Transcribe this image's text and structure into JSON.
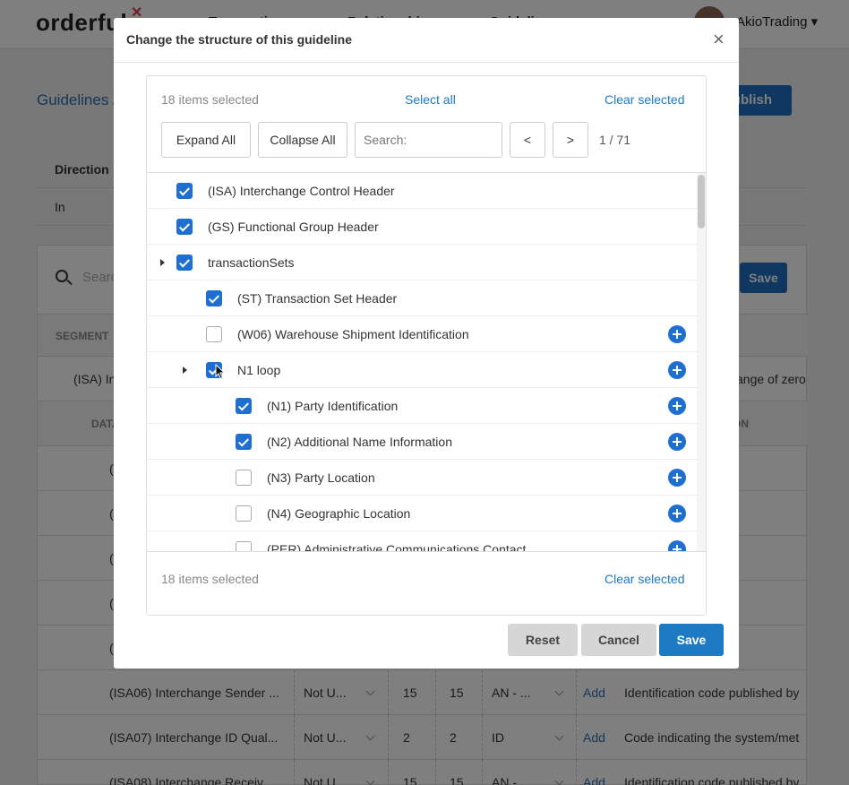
{
  "background": {
    "logo": "orderful",
    "nav": [
      "Transactions",
      "Relationships",
      "Guidelines"
    ],
    "account": "AkioTrading ▾",
    "breadcrumb": "Guidelines /",
    "publish": "Publish",
    "direction_header": "Direction",
    "direction_value": "In",
    "search_placeholder": "Search",
    "save": "Save",
    "segment_header": "SEGMENT",
    "segment_row": "(ISA) In",
    "segment_desc": "ange of zero",
    "data_header": "DATA",
    "description_header": "ON",
    "rows": [
      {
        "name": "(I",
        "desc": "type of info"
      },
      {
        "name": "(I",
        "desc": "additional"
      },
      {
        "name": "(I",
        "desc": "type of info"
      },
      {
        "name": "(I",
        "desc": "tifying the s"
      },
      {
        "name": "(I",
        "desc": "system/met"
      },
      {
        "name": "(ISA06) Interchange Sender ...",
        "usage": "Not U...",
        "min": "15",
        "max": "15",
        "type": "AN - ...",
        "add": "Add",
        "desc": "Identification code published by"
      },
      {
        "name": "(ISA07) Interchange ID Qual...",
        "usage": "Not U...",
        "min": "2",
        "max": "2",
        "type": "ID",
        "add": "Add",
        "desc": "Code indicating the system/met"
      },
      {
        "name": "(ISA08) Interchange Receiv...",
        "usage": "Not U...",
        "min": "15",
        "max": "15",
        "type": "AN - ...",
        "add": "Add",
        "desc": "Identification code published by"
      }
    ]
  },
  "modal": {
    "title": "Change the structure of this guideline",
    "close": "×",
    "selected_count": "18 items selected",
    "select_all": "Select all",
    "clear_selected": "Clear selected",
    "expand_all": "Expand All",
    "collapse_all": "Collapse All",
    "search_placeholder": "Search:",
    "prev": "<",
    "next": ">",
    "pager": "1 / 71",
    "items": [
      {
        "label": "(ISA) Interchange Control Header",
        "checked": true,
        "level": 0,
        "expandable": false,
        "addable": false
      },
      {
        "label": "(GS) Functional Group Header",
        "checked": true,
        "level": 0,
        "expandable": false,
        "addable": false
      },
      {
        "label": "transactionSets",
        "checked": true,
        "level": 0,
        "expandable": true,
        "addable": false
      },
      {
        "label": "(ST) Transaction Set Header",
        "checked": true,
        "level": 1,
        "expandable": false,
        "addable": false
      },
      {
        "label": "(W06) Warehouse Shipment Identification",
        "checked": false,
        "level": 1,
        "expandable": false,
        "addable": true
      },
      {
        "label": "N1 loop",
        "checked": true,
        "level": 1,
        "expandable": true,
        "addable": true
      },
      {
        "label": "(N1) Party Identification",
        "checked": true,
        "level": 2,
        "expandable": false,
        "addable": true
      },
      {
        "label": "(N2) Additional Name Information",
        "checked": true,
        "level": 2,
        "expandable": false,
        "addable": true
      },
      {
        "label": "(N3) Party Location",
        "checked": false,
        "level": 2,
        "expandable": false,
        "addable": true
      },
      {
        "label": "(N4) Geographic Location",
        "checked": false,
        "level": 2,
        "expandable": false,
        "addable": true
      },
      {
        "label": "(PER) Administrative Communications Contact",
        "checked": false,
        "level": 2,
        "expandable": false,
        "addable": true
      }
    ],
    "footer_selected_count": "18 items selected",
    "footer_clear_selected": "Clear selected",
    "reset": "Reset",
    "cancel": "Cancel",
    "save": "Save"
  },
  "colors": {
    "accent": "#1f6fd2",
    "link": "#1f7ac4",
    "save": "#1f7ac4"
  }
}
